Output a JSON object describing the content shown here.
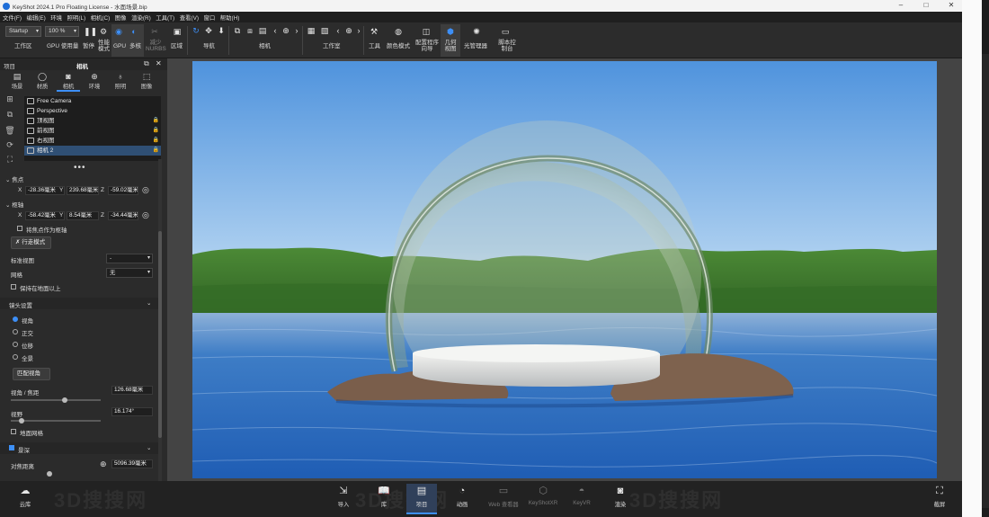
{
  "window": {
    "title": "KeyShot 2024.1 Pro Floating License  - 水面场景.bip"
  },
  "menu": [
    "文件(F)",
    "编辑(E)",
    "环境",
    "照明(L)",
    "相机(C)",
    "图像",
    "渲染(R)",
    "工具(T)",
    "查看(V)",
    "窗口",
    "帮助(H)"
  ],
  "toolbar": {
    "workspace_select": "Startup",
    "zoom_select": "100 %",
    "labels": {
      "workspace": "工作区",
      "gpu_usage": "GPU 使用量",
      "pause": "暂停",
      "perf_mode": "性能模式",
      "gpu": "GPU",
      "multi": "多核",
      "reduce_nurbs": "减少NURBS",
      "region": "区域",
      "navigate": "导航",
      "camera": "相机",
      "studio": "工作室",
      "tools": "工具",
      "color_mode": "颜色模式",
      "config_wizard": "配置程序向导",
      "geometry_view": "几何视图",
      "light_manager": "光管理器",
      "script_console": "脚本控制台"
    }
  },
  "panel": {
    "header_left": "项目",
    "header_title": "相机",
    "tabs": [
      {
        "label": "场景",
        "icon": "scene-icon"
      },
      {
        "label": "材质",
        "icon": "material-icon"
      },
      {
        "label": "相机",
        "icon": "camera-icon"
      },
      {
        "label": "环境",
        "icon": "environment-icon"
      },
      {
        "label": "照明",
        "icon": "lighting-icon"
      },
      {
        "label": "图像",
        "icon": "image-icon"
      }
    ],
    "cameras": [
      "Free Camera",
      "Perspective",
      "顶视图",
      "前视图",
      "右视图",
      "相机 2"
    ],
    "selected_camera": "相机 2",
    "focal_point": {
      "label": "焦点",
      "x": "-28.36毫米",
      "y": "239.68毫米",
      "z": "-59.02毫米"
    },
    "pivot": {
      "label": "枢轴",
      "x": "-58.42毫米",
      "y": "8.54毫米",
      "z": "-34.44毫米"
    },
    "axis_x": "X",
    "axis_y": "Y",
    "axis_z": "Z",
    "use_focus_as_pivot": "将焦点作为枢轴",
    "walk_mode": "行走模式",
    "standard_view": {
      "label": "标准视图",
      "value": "-"
    },
    "grid": {
      "label": "网格",
      "value": "无"
    },
    "keep_above_ground": "保持在地面以上",
    "lens_section": "镜头设置",
    "lens_options": [
      "视角",
      "正交",
      "位移",
      "全景"
    ],
    "lens_selected": "视角",
    "match_perspective": "匹配视角",
    "angle_focal": {
      "label": "视角 / 焦距",
      "value": "126.68毫米",
      "fraction": 0.6
    },
    "fov": {
      "label": "视野",
      "value": "16.174°",
      "fraction": 0.12
    },
    "ground_grid": "地面网格",
    "dof_section": "景深",
    "focus_distance": {
      "label": "对焦距离",
      "value": "5096.39毫米"
    }
  },
  "bottombar": [
    {
      "label": "云库",
      "icon": "cloud-library-icon"
    },
    {
      "label": "导入",
      "icon": "import-icon"
    },
    {
      "label": "库",
      "icon": "library-icon"
    },
    {
      "label": "项目",
      "icon": "project-icon"
    },
    {
      "label": "动画",
      "icon": "animation-icon"
    },
    {
      "label": "Web 查看器",
      "icon": "web-viewer-icon"
    },
    {
      "label": "KeyShotXR",
      "icon": "keyshotxr-icon"
    },
    {
      "label": "KeyVR",
      "icon": "keyvr-icon"
    },
    {
      "label": "渲染",
      "icon": "render-icon"
    },
    {
      "label": "截屏",
      "icon": "screenshot-icon"
    }
  ],
  "watermarks": [
    "3D搜搜网",
    "3D搜搜网",
    "3D搜搜网"
  ],
  "colors": {
    "accent": "#3d8ff7",
    "panel": "#2b2b2b",
    "sky_top": "#5b9be0",
    "water": "#2d6fbf",
    "grass": "#3f7a2c"
  }
}
